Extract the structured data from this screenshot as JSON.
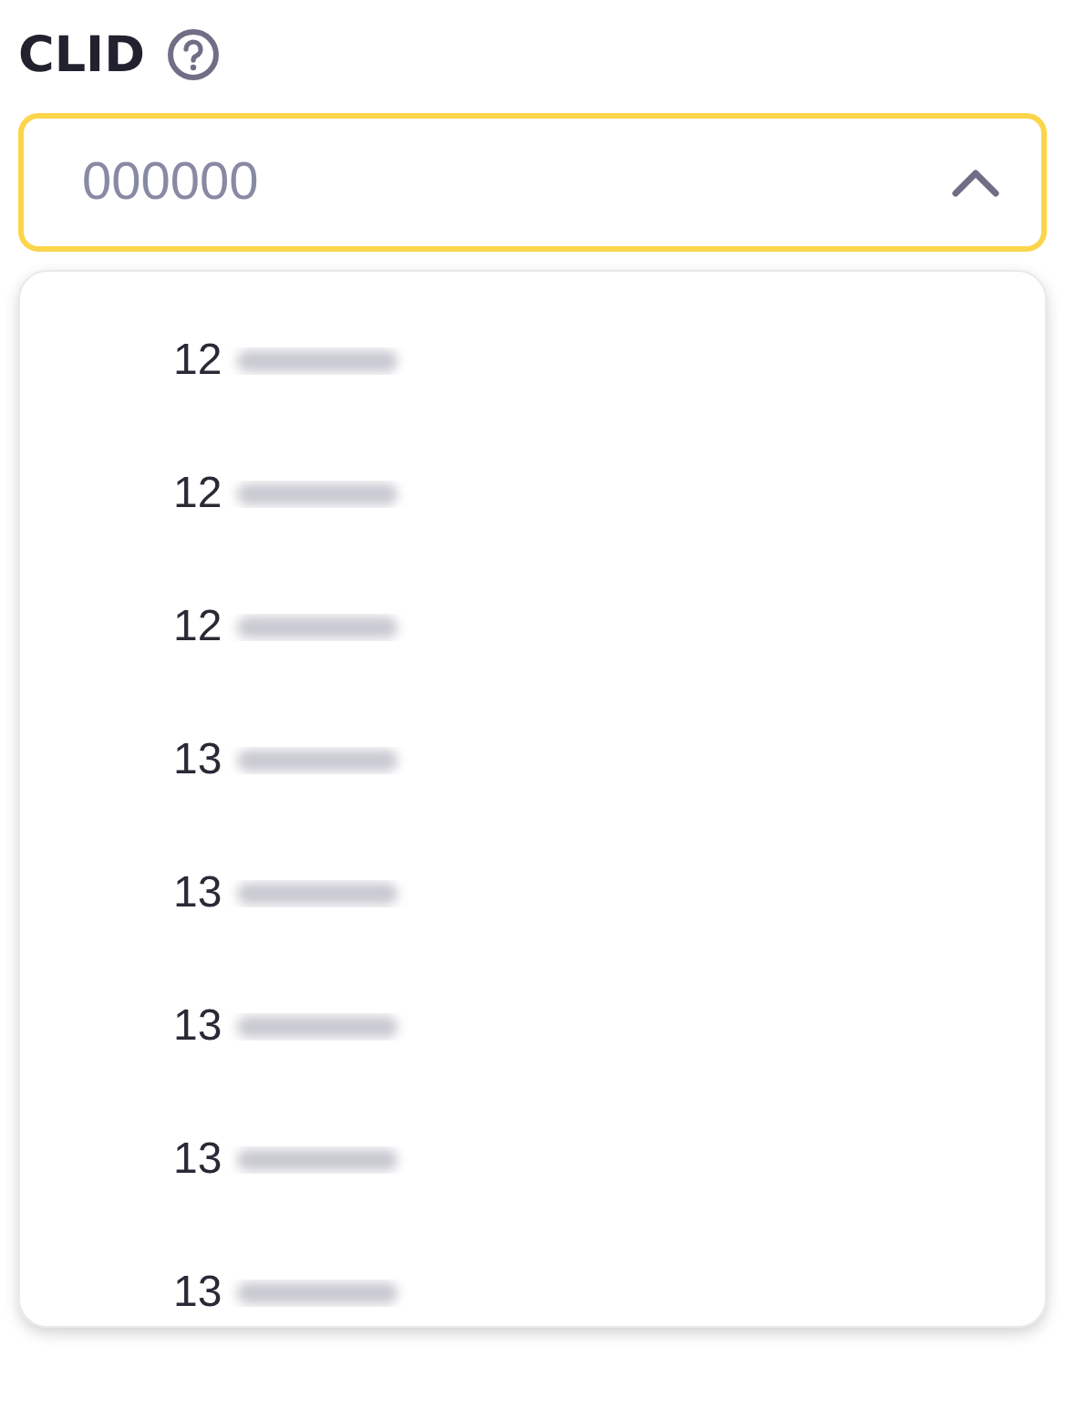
{
  "field": {
    "label": "CLID",
    "placeholder": "000000",
    "expanded": true
  },
  "options": [
    {
      "text": "12",
      "redacted": true
    },
    {
      "text": "12",
      "redacted": true
    },
    {
      "text": "12",
      "redacted": true
    },
    {
      "text": "13",
      "redacted": true
    },
    {
      "text": "13",
      "redacted": true
    },
    {
      "text": "13",
      "redacted": true
    },
    {
      "text": "13",
      "redacted": true
    },
    {
      "text": "13",
      "redacted": true
    }
  ]
}
